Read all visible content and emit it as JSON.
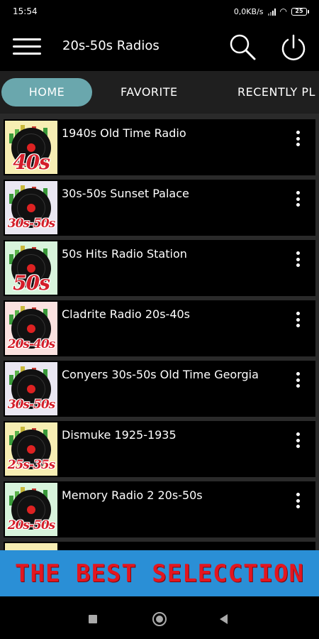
{
  "status_bar": {
    "time": "15:54",
    "net_speed": "0,0KB/s",
    "battery": "25"
  },
  "app_bar": {
    "title": "20s-50s Radios"
  },
  "tabs": [
    {
      "label": "HOME",
      "active": true
    },
    {
      "label": "FAVORITE",
      "active": false
    },
    {
      "label": "RECENTLY PL",
      "active": false
    }
  ],
  "stations": [
    {
      "name": "1940s Old Time Radio",
      "decade_label": "40s",
      "thumb_bg": "#f7eeb3"
    },
    {
      "name": "30s-50s Sunset Palace",
      "decade_label": "30s-50s",
      "thumb_bg": "#eae7f2"
    },
    {
      "name": "50s Hits Radio Station",
      "decade_label": "50s",
      "thumb_bg": "#d8f4dc"
    },
    {
      "name": "Cladrite Radio 20s-40s",
      "decade_label": "20s-40s",
      "thumb_bg": "#fbe2e0"
    },
    {
      "name": "Conyers 30s-50s Old Time Georgia",
      "decade_label": "30s-50s",
      "thumb_bg": "#eae7f2"
    },
    {
      "name": "Dismuke 1925-1935",
      "decade_label": "25s-35s",
      "thumb_bg": "#f7eeb3"
    },
    {
      "name": "Memory Radio 2 20s-50s",
      "decade_label": "20s-50s",
      "thumb_bg": "#d8f4dc"
    }
  ],
  "banner": {
    "text": "THE BEST SELECCTION"
  },
  "colors": {
    "tab_active": "#6aa7ad",
    "banner_bg": "#2a8fd6",
    "banner_text": "#e3161f"
  },
  "icons": [
    "menu-icon",
    "search-icon",
    "power-icon",
    "more-vert-icon",
    "nav-recents-icon",
    "nav-home-icon",
    "nav-back-icon"
  ]
}
